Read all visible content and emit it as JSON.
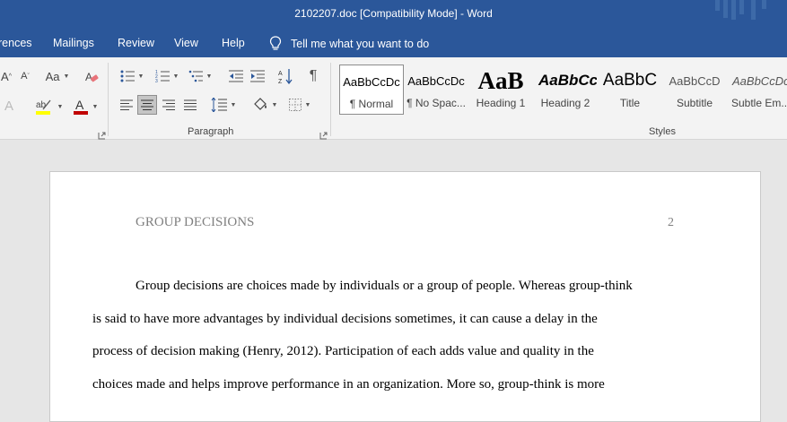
{
  "window": {
    "title": "2102207.doc [Compatibility Mode]  -  Word"
  },
  "menu": {
    "tabs": [
      "rences",
      "Mailings",
      "Review",
      "View",
      "Help"
    ],
    "tell_me": "Tell me what you want to do"
  },
  "ribbon": {
    "font_group": {
      "grow_label": "A",
      "shrink_label": "A",
      "change_case_label": "Aa",
      "text_effects_label": "A",
      "font_color_label": "A",
      "font_color": "#c00000",
      "highlight_label": "ab",
      "highlight_color": "#ffff00"
    },
    "paragraph_label": "Paragraph",
    "pilcrow": "¶",
    "styles_label": "Styles",
    "styles": [
      {
        "sample": "AaBbCcDc",
        "name": "¶ Normal",
        "selected": true
      },
      {
        "sample": "AaBbCcDc",
        "name": "¶ No Spac..."
      },
      {
        "sample": "AaB",
        "name": "Heading 1"
      },
      {
        "sample": "AaBbCc",
        "name": "Heading 2"
      },
      {
        "sample": "AaBbC",
        "name": "Title"
      },
      {
        "sample": "AaBbCcD",
        "name": "Subtitle"
      },
      {
        "sample": "AaBbCcDc",
        "name": "Subtle Em..."
      }
    ]
  },
  "document": {
    "header": "GROUP DECISIONS",
    "page_number": "2",
    "lines": [
      "Group decisions are choices made by individuals or a group of people. Whereas group-think",
      "is said to have more advantages by individual decisions sometimes, it can cause a delay in the",
      "process of decision making (Henry, 2012).  Participation of each adds value and quality in the",
      "choices made and helps improve performance in an organization. More so, group-think is more"
    ]
  },
  "colors": {
    "title_bar": "#2b579a",
    "ribbon": "#f3f3f3",
    "canvas": "#e6e6e6"
  }
}
